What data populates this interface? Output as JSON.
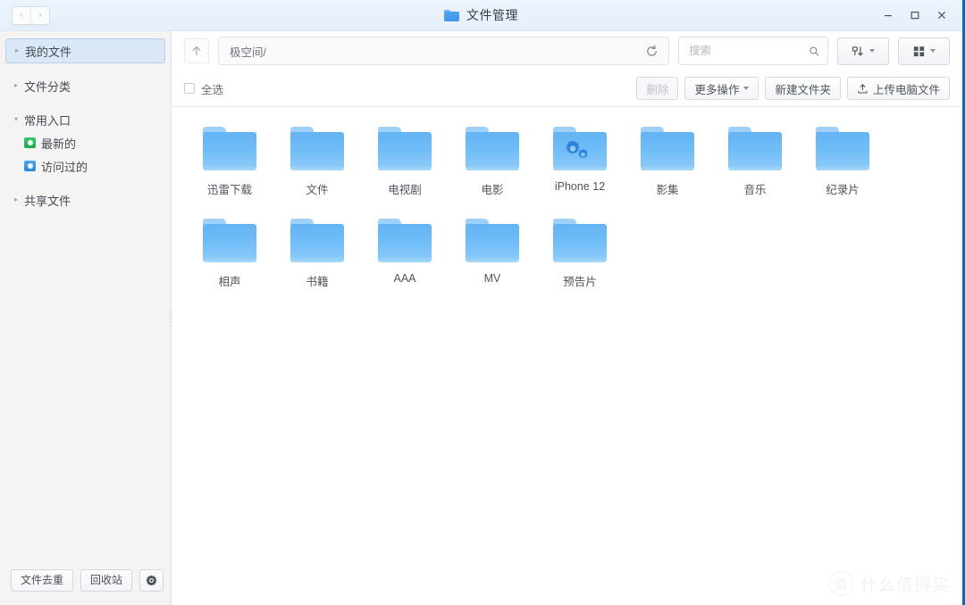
{
  "window": {
    "title": "文件管理",
    "title_icon": "folder-icon",
    "nav": {
      "back": "‹",
      "back_icon": "chevron-left-icon",
      "forward": "›",
      "forward_icon": "chevron-right-icon"
    },
    "controls": {
      "minimize": "minimize-icon",
      "maximize": "maximize-icon",
      "close": "close-icon"
    }
  },
  "sidebar": {
    "items": [
      {
        "label": "我的文件",
        "caret": "▸",
        "selected": true,
        "type": "group"
      },
      {
        "label": "文件分类",
        "caret": "▸",
        "selected": false,
        "type": "group"
      },
      {
        "label": "常用入口",
        "caret": "▾",
        "selected": false,
        "type": "group"
      },
      {
        "label": "共享文件",
        "caret": "▸",
        "selected": false,
        "type": "group"
      }
    ],
    "children": [
      {
        "label": "最新的",
        "icon": "recent-folder-icon",
        "color": "#27ad59"
      },
      {
        "label": "访问过的",
        "icon": "visited-folder-icon",
        "color": "#3a8fda"
      }
    ],
    "footer": {
      "dedupe_label": "文件去重",
      "recycle_label": "回收站",
      "settings_icon": "gear-icon"
    }
  },
  "toolbar": {
    "up_icon": "arrow-up-icon",
    "path_value": "极空间/",
    "refresh_icon": "refresh-icon",
    "search_placeholder": "搜索",
    "search_value": "",
    "search_icon": "search-icon",
    "sort_icon": "sort-icon",
    "view_icon": "grid-view-icon"
  },
  "actionbar": {
    "select_all_label": "全选",
    "select_all_checked": false,
    "delete_label": "删除",
    "delete_disabled": true,
    "more_label": "更多操作",
    "new_folder_label": "新建文件夹",
    "upload_label": "上传电脑文件",
    "upload_icon": "upload-icon"
  },
  "files": [
    {
      "name": "迅雷下载",
      "type": "folder",
      "overlay": "none"
    },
    {
      "name": "文件",
      "type": "folder",
      "overlay": "none"
    },
    {
      "name": "电视剧",
      "type": "folder",
      "overlay": "none"
    },
    {
      "name": "电影",
      "type": "folder",
      "overlay": "none"
    },
    {
      "name": "iPhone 12",
      "type": "folder",
      "overlay": "gears"
    },
    {
      "name": "影集",
      "type": "folder",
      "overlay": "none"
    },
    {
      "name": "音乐",
      "type": "folder",
      "overlay": "none"
    },
    {
      "name": "纪录片",
      "type": "folder",
      "overlay": "none"
    },
    {
      "name": "相声",
      "type": "folder",
      "overlay": "none"
    },
    {
      "name": "书籍",
      "type": "folder",
      "overlay": "none"
    },
    {
      "name": "AAA",
      "type": "folder",
      "overlay": "none"
    },
    {
      "name": "MV",
      "type": "folder",
      "overlay": "none"
    },
    {
      "name": "预告片",
      "type": "folder",
      "overlay": "none"
    }
  ],
  "watermark": {
    "badge": "值",
    "text": "什么值得买"
  },
  "colors": {
    "accent": "#3f95e8",
    "folder": "#6fbcf7",
    "selection": "#dae8f7",
    "window_border": "#1766ad"
  }
}
